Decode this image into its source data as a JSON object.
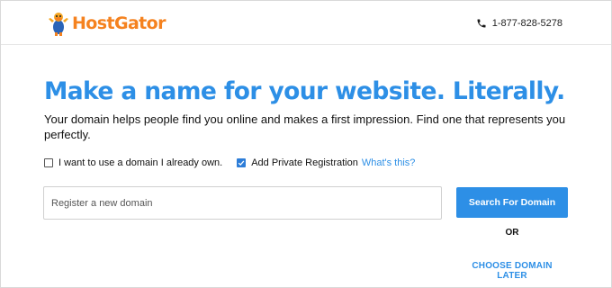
{
  "header": {
    "brand": "HostGator",
    "phone": "1-877-828-5278",
    "phone_icon": "phone-icon",
    "brand_color": "#f5821f"
  },
  "main": {
    "headline": "Make a name for your website. Literally.",
    "subtext": "Your domain helps people find you online and makes a first impression. Find one that represents you perfectly.",
    "options": {
      "own_domain": {
        "label": "I want to use a domain I already own.",
        "checked": false
      },
      "private_registration": {
        "label": "Add Private Registration",
        "checked": true,
        "link": "What's this?"
      }
    },
    "search": {
      "placeholder": "Register a new domain",
      "button_label": "Search For Domain"
    },
    "or_label": "OR",
    "choose_later_label": "CHOOSE DOMAIN LATER",
    "accent_color": "#2d8fe6"
  }
}
